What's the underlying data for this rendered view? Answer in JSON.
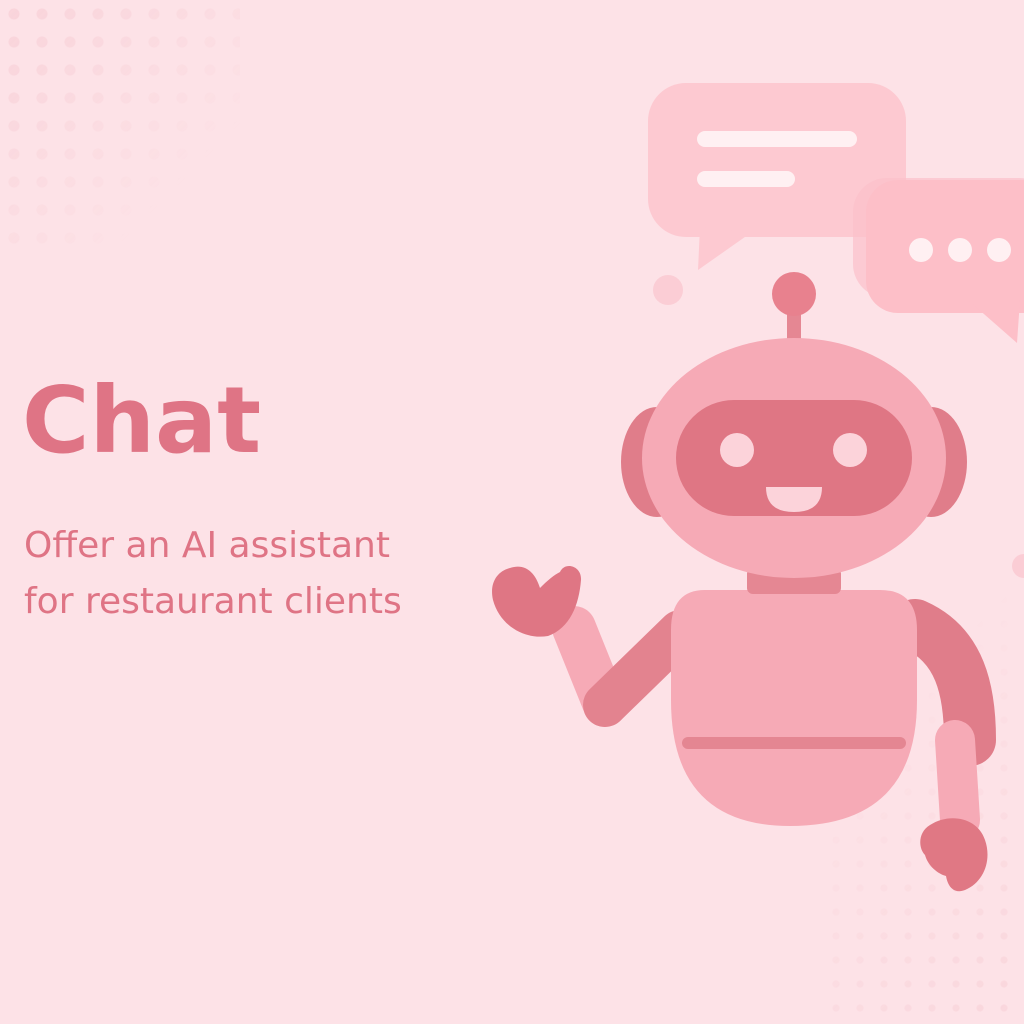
{
  "hero": {
    "title": "Chat",
    "subtitle_line1": "Offer an AI assistant",
    "subtitle_line2": "for restaurant clients"
  },
  "illustration": {
    "subject": "robot-mascot",
    "icons": [
      "chat-bubble-lines-icon",
      "chat-bubble-typing-icon",
      "robot-icon"
    ]
  },
  "colors": {
    "background": "#fde2e7",
    "accent": "#df7485",
    "robot_light": "#f8b1bc",
    "robot_dark": "#e07884",
    "bubble": "#ffc8d0"
  }
}
